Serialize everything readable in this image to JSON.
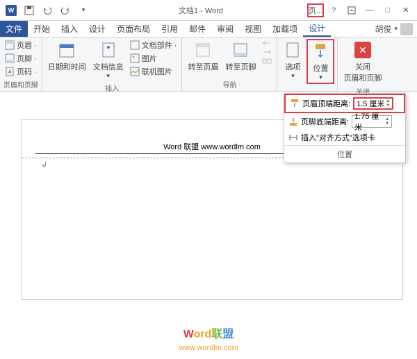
{
  "titlebar": {
    "title": "文档1 - Word",
    "page_btn": "页..."
  },
  "tabs": {
    "file": "文件",
    "start": "开始",
    "insert": "插入",
    "design": "设计",
    "layout": "页面布局",
    "ref": "引用",
    "mail": "邮件",
    "review": "审阅",
    "view": "视图",
    "addin": "加载项",
    "hdrftr": "设计",
    "user": "胡俊"
  },
  "ribbon": {
    "g1": {
      "header": "页眉 ·",
      "footer": "页脚 ·",
      "pageno": "页码 ·",
      "label": "页眉和页脚"
    },
    "g2": {
      "datetime": "日期和时间",
      "docinfo": "文档信息",
      "docparts": "文档部件 ·",
      "picture": "图片",
      "online": "联机图片",
      "label": "插入"
    },
    "g3": {
      "gohdr": "转至页眉",
      "goftr": "转至页脚",
      "label": "导航"
    },
    "g4": {
      "options": "选项",
      "position": "位置",
      "label": ""
    },
    "g5": {
      "close1": "关闭",
      "close2": "页眉和页脚",
      "label": "关闭"
    }
  },
  "dropdown": {
    "top_label": "页眉顶端距离:",
    "top_val": "1.5 厘米",
    "bot_label": "页脚底端距离:",
    "bot_val": "1.75 厘米",
    "align": "插入\"对齐方式\"选项卡",
    "footer": "位置"
  },
  "doc": {
    "header_text": "Word 联盟  www.wordlm.com"
  },
  "watermark": {
    "w": "W",
    "ord": "ord",
    "lian": "联",
    "meng": "盟",
    "url": "www.wordlm.com"
  }
}
